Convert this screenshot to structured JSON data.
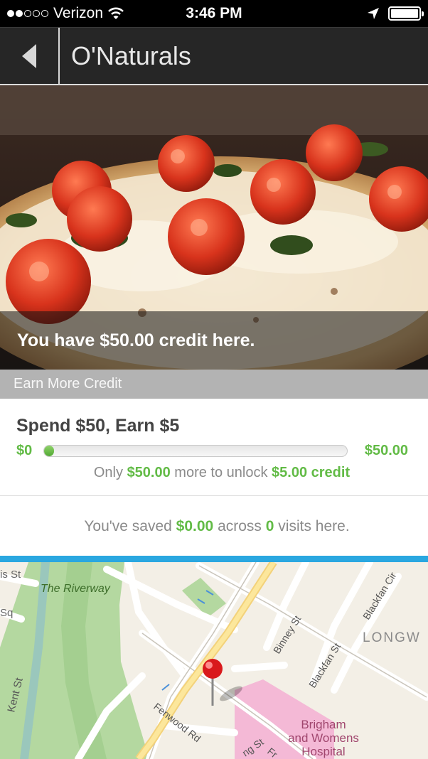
{
  "status_bar": {
    "carrier": "Verizon",
    "time": "3:46 PM",
    "signal_bars": 2,
    "signal_total": 5
  },
  "nav": {
    "title": "O'Naturals"
  },
  "hero": {
    "caption": "You have $50.00 credit here."
  },
  "section": {
    "header": "Earn More Credit"
  },
  "offer": {
    "title": "Spend $50, Earn $5",
    "range_min": "$0",
    "range_max": "$50.00",
    "progress_fraction": 0.0,
    "unlock_prefix": "Only",
    "unlock_amount": "$50.00",
    "unlock_middle": "more to unlock",
    "unlock_reward": "$5.00 credit"
  },
  "savings": {
    "prefix": "You've saved",
    "amount": "$0.00",
    "middle": "across",
    "visits": "0",
    "suffix": "visits here."
  },
  "map": {
    "labels": {
      "riverway": "The Riverway",
      "kent_st": "Kent St",
      "fenwood_rd": "Fenwood Rd",
      "binney_st": "Binney St",
      "blackfan_st": "Blackfan St",
      "blackfan_cir": "Blackfan Cir",
      "longwood": "LONGW",
      "hospital_line1": "Brigham",
      "hospital_line2": "and Womens",
      "hospital_line3": "Hospital",
      "is_st": "is St",
      "sq": "Sq",
      "ng_st": "ng St",
      "fr": "Fr"
    }
  },
  "colors": {
    "accent_green": "#62bb46",
    "nav_background": "#262626",
    "divider_blue": "#2aa7e0",
    "section_grey": "#b3b3b3"
  }
}
